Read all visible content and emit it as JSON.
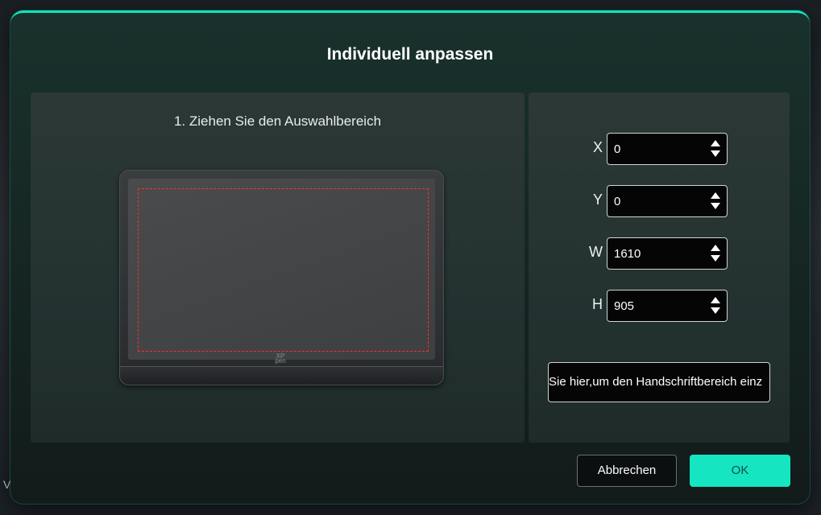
{
  "background": {
    "partial_text": "V"
  },
  "dialog": {
    "title": "Individuell anpassen",
    "accent_color": "#14e3bf"
  },
  "preview": {
    "instruction": "1. Ziehen Sie den Auswahlbereich",
    "tablet_logo": "XP pen",
    "selection_color": "#ff2e2e"
  },
  "fields": [
    {
      "label": "X",
      "value": "0"
    },
    {
      "label": "Y",
      "value": "0"
    },
    {
      "label": "W",
      "value": "1610"
    },
    {
      "label": "H",
      "value": "905"
    }
  ],
  "handwriting_button": {
    "label": "Sie hier,um den Handschriftbereich einz"
  },
  "buttons": {
    "cancel_label": "Abbrechen",
    "ok_label": "OK",
    "ok_color": "#16e5c2"
  }
}
